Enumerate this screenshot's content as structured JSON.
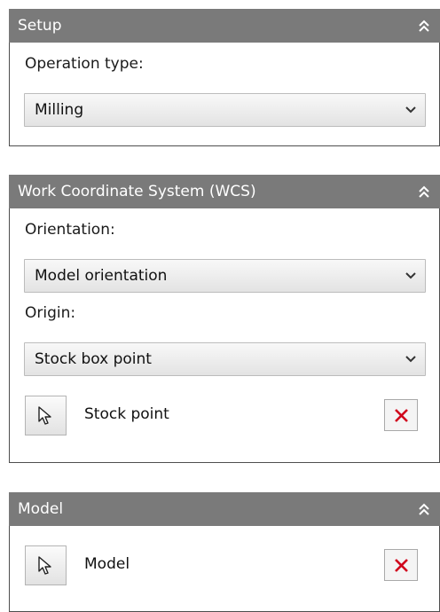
{
  "setup": {
    "title": "Setup",
    "operation_type_label": "Operation type:",
    "operation_type_value": "Milling"
  },
  "wcs": {
    "title": "Work Coordinate System (WCS)",
    "orientation_label": "Orientation:",
    "orientation_value": "Model orientation",
    "origin_label": "Origin:",
    "origin_value": "Stock box point",
    "stock_point_label": "Stock point"
  },
  "model": {
    "title": "Model",
    "model_label": "Model"
  },
  "icons": {
    "collapse": "double-chevron-up-icon",
    "dropdown": "chevron-down-icon",
    "select": "cursor-arrow-icon",
    "clear": "red-x-icon"
  },
  "colors": {
    "header_bg": "#7a7a7a",
    "clear_red": "#d0021b"
  }
}
